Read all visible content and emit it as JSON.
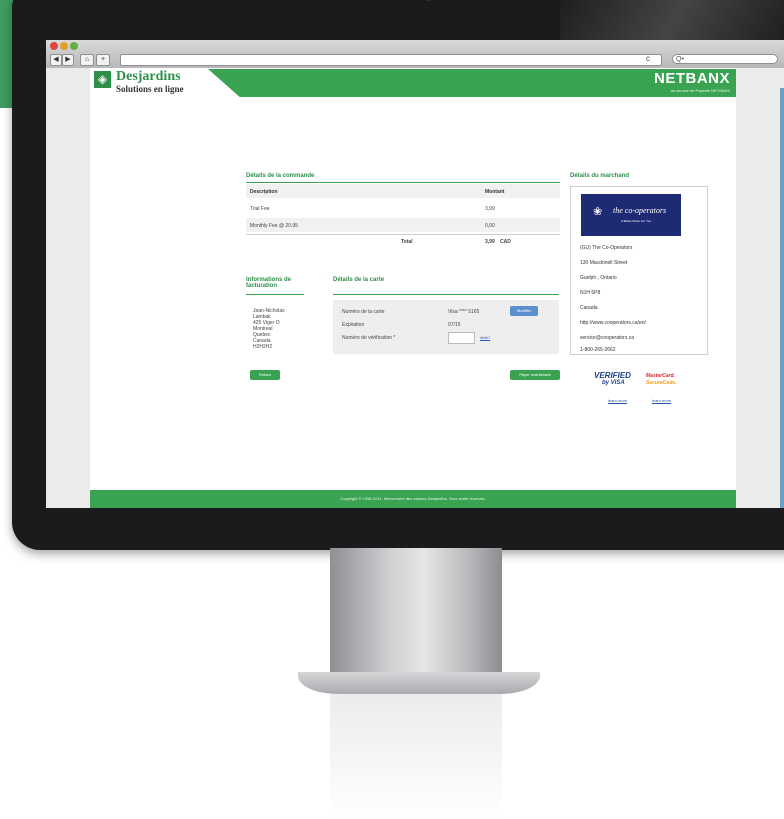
{
  "browser": {
    "nav_back": "◀",
    "nav_fwd": "▶",
    "home": "⌂",
    "add": "+",
    "reload": "c",
    "search_placeholder": "Q•"
  },
  "header": {
    "brand": "Desjardins",
    "brand_sub": "Solutions en ligne",
    "netbanx": "NETBANX",
    "netbanx_sub": "au service de Paysafe NETBANX"
  },
  "order": {
    "title": "Détails de la commande",
    "col_description": "Description",
    "col_amount": "Montant",
    "rows": [
      {
        "description": "Trial Fee",
        "amount": "3,99"
      },
      {
        "description": "Monthly Fee @ 20.95",
        "amount": "0,00"
      }
    ],
    "total_label": "Total",
    "total_value": "3,99",
    "currency": "CAD"
  },
  "billing": {
    "title": "Informations de facturation",
    "lines": [
      "Jean-Nicholas",
      "Lambak",
      "425 Viger O",
      "Montreal",
      "Quebec",
      "Canada",
      "H2H2H2"
    ]
  },
  "card": {
    "title": "Détails de la carte",
    "number_label": "Numéro de la carte",
    "number_value": "Visa **** 5165",
    "modify_button": "Modifier",
    "expiration_label": "Expiration",
    "expiration_value": "07/15",
    "cvv_label": "Numéro de vérification *",
    "help_link": "Aide?"
  },
  "merchant": {
    "title": "Détails du marchand",
    "logo_text": "the co-operators",
    "logo_sub": "A Better Place For You",
    "lines": [
      "(GU) The Co-Operators",
      "130 Macdonell Street",
      "Guelph , Ontario",
      "N1H 6P8",
      "Canada",
      "http://www.cooperators.ca/en/",
      "service@cooperators.ca",
      "1-800-265-2662"
    ]
  },
  "buttons": {
    "back": "Retour",
    "pay": "Payer maintenant"
  },
  "badges": {
    "visa_line1": "VERIFIED",
    "visa_line2": "by VISA",
    "mc_line1": "MasterCard.",
    "mc_line2": "SecureCode.",
    "learn_more": "learn more"
  },
  "footer": {
    "copyright": "Copyright © 1998-2011. Mouvement des caisses Desjardins. Tous droits réservés."
  },
  "colors": {
    "brand_green": "#39a352",
    "text_green": "#2e8f49",
    "monitor_dark": "#1b1b1d",
    "merchant_navy": "#1f2a74"
  }
}
